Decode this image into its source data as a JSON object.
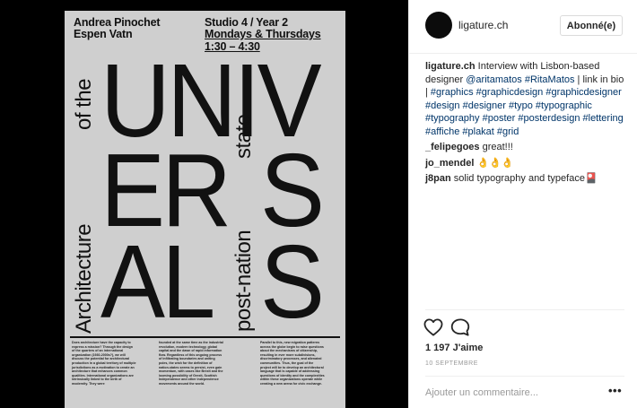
{
  "poster": {
    "names_line1": "Andrea Pinochet",
    "names_line2": "Espen Vatn",
    "studio": "Studio 4 / Year 2",
    "days": "Mondays & Thursdays",
    "time": "1:30 – 4:30",
    "big_row1": "UNIV",
    "big_row2_left": "ER",
    "big_row2_right": "S",
    "big_row3_left": "AL",
    "big_row3_right": "S",
    "vertical_left": "Architecture",
    "vertical_left_top": "of the",
    "vertical_right": "post-nation",
    "vertical_right_top": "state",
    "body_col1": "Does architecture have the capacity to express a mission? Through the design of the quarters of an international organization (1930-2000s?), we will discuss the potential for architectural production in a global territory of multiple jurisdictions as a motivation to create an architecture that enhances common qualities. International organizations are intrinsically linked to the birth of modernity. They were",
    "body_col2": "founded at the same time as the industrial revolution, modern technology, global capital and the dawn of rapid information flow. Regardless of this ongoing process of infiltrating boundaries and uniting poles, the wish for the definition of nation-states seems to persist, even gain momentum, with cases like Brexit and the looming possibility of Grexit, Scottish Independence and other independence movements around the world.",
    "body_col3": "Parallel to this, new migration patterns across the globe begin to raise questions about the mechanisms of citizenship, resulting in ever more subdivisions, discriminatory processes, and alienated communities. Thus, the goal of the project will be to develop an architectural language that is capable of addressing questions of identity and the complexities within these organizations operate while creating a new arena for civic exchange."
  },
  "header": {
    "username": "ligature.ch",
    "follow_label": "Abonné(e)"
  },
  "caption": {
    "username": "ligature.ch",
    "text1": " Interview with Lisbon-based designer ",
    "link1": "@aritamatos",
    "link2": "#RitaMatos",
    "text2": " | link in bio | ",
    "hashtags": "#graphics #graphicdesign #graphicdesigner #design #designer #typo #typographic #typography #poster #posterdesign #lettering #affiche #plakat #grid"
  },
  "comments": [
    {
      "user": "_felipegoes",
      "text": " great!!!"
    },
    {
      "user": "jo_mendel",
      "text": " 👌👌👌"
    },
    {
      "user": "j8pan",
      "text": " solid typography and typeface🎴"
    }
  ],
  "likes": "1 197 J'aime",
  "date": "10 SEPTEMBRE",
  "add_comment_placeholder": "Ajouter un commentaire...",
  "more_label": "•••",
  "colors": {
    "link": "#003569",
    "text": "#262626",
    "muted": "#999999",
    "border": "#efefef"
  },
  "icons": {
    "like": "heart-icon",
    "comment": "comment-icon",
    "more": "more-options-icon"
  }
}
